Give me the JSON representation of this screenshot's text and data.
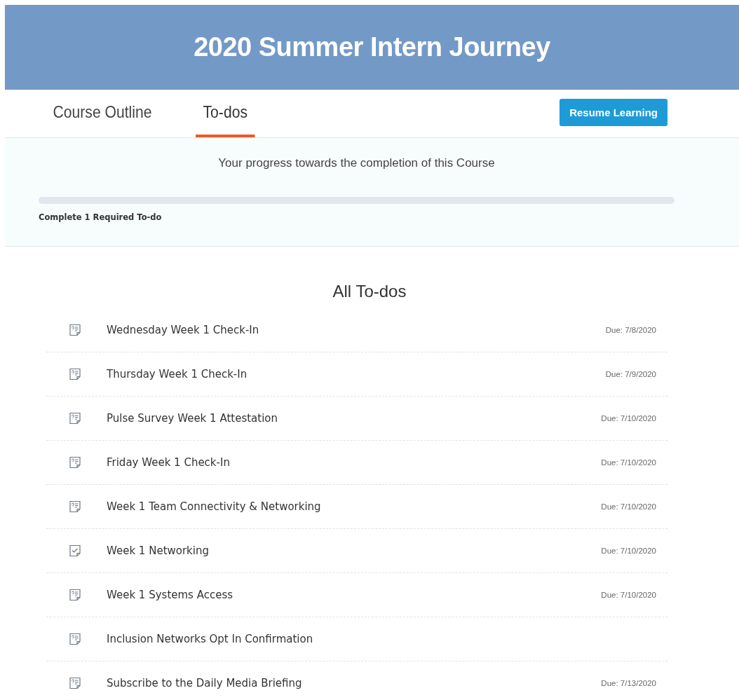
{
  "header": {
    "title": "2020 Summer Intern Journey"
  },
  "tabs": [
    {
      "label": "Course Outline",
      "selected": false
    },
    {
      "label": "To-dos",
      "selected": true
    }
  ],
  "resume_button": "Resume Learning",
  "progress": {
    "caption": "Your progress towards the completion of this Course",
    "note": "Complete 1 Required To-do"
  },
  "todos": {
    "title": "All To-dos",
    "items": [
      {
        "kind": "survey",
        "title": "Wednesday Week 1 Check-In",
        "due": "Due: 7/8/2020"
      },
      {
        "kind": "survey",
        "title": "Thursday Week 1 Check-In",
        "due": "Due: 7/9/2020"
      },
      {
        "kind": "survey",
        "title": "Pulse Survey Week 1 Attestation",
        "due": "Due: 7/10/2020"
      },
      {
        "kind": "survey",
        "title": "Friday Week 1 Check-In",
        "due": "Due: 7/10/2020"
      },
      {
        "kind": "survey",
        "title": "Week 1 Team Connectivity & Networking",
        "due": "Due: 7/10/2020"
      },
      {
        "kind": "task",
        "title": "Week 1 Networking",
        "due": "Due: 7/10/2020"
      },
      {
        "kind": "survey",
        "title": "Week 1 Systems Access",
        "due": "Due: 7/10/2020"
      },
      {
        "kind": "survey",
        "title": "Inclusion Networks Opt In Confirmation"
      },
      {
        "kind": "survey",
        "title": "Subscribe to the Daily Media Briefing",
        "due": "Due: 7/13/2020"
      }
    ]
  }
}
